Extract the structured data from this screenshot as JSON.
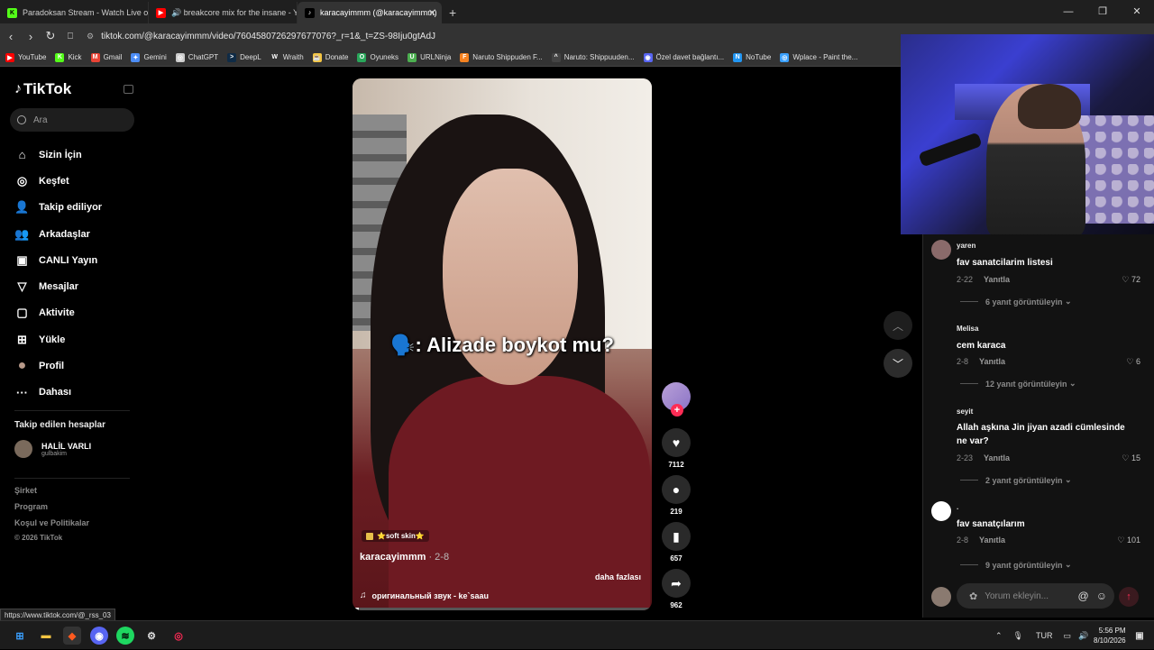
{
  "tabs": [
    {
      "title": "Paradoksan Stream - Watch Live on K",
      "icon_color": "#53fc18",
      "icon_text": "K"
    },
    {
      "title": "🔊 breakcore mix for the insane - Yo",
      "icon_color": "#ff0000",
      "icon_text": "▶"
    },
    {
      "title": "karacayimmm (@karacayimmm)",
      "icon_color": "#000000",
      "icon_text": "♪",
      "active": true
    }
  ],
  "url": "tiktok.com/@karacayimmm/video/7604580726297677076?_r=1&_t=ZS-98Iju0gtAdJ",
  "bookmarks": [
    {
      "label": "YouTube",
      "color": "#ff0000",
      "glyph": "▶"
    },
    {
      "label": "Kick",
      "color": "#53fc18",
      "glyph": "K"
    },
    {
      "label": "Gmail",
      "color": "#ea4335",
      "glyph": "M"
    },
    {
      "label": "Gemini",
      "color": "#4c8df6",
      "glyph": "✦"
    },
    {
      "label": "ChatGPT",
      "color": "#cccccc",
      "glyph": "◎"
    },
    {
      "label": "DeepL",
      "color": "#0f2b46",
      "glyph": ">"
    },
    {
      "label": "Wraith",
      "color": "#333333",
      "glyph": "W"
    },
    {
      "label": "Donate",
      "color": "#f5c542",
      "glyph": "☕"
    },
    {
      "label": "Oyuneks",
      "color": "#29a65a",
      "glyph": "O"
    },
    {
      "label": "URLNinja",
      "color": "#4caf50",
      "glyph": "U"
    },
    {
      "label": "Naruto Shippuden F...",
      "color": "#f58220",
      "glyph": "F"
    },
    {
      "label": "Naruto: Shippuuden...",
      "color": "#444444",
      "glyph": "^"
    },
    {
      "label": "Özel davet bağlantı...",
      "color": "#5865f2",
      "glyph": "◉"
    },
    {
      "label": "NoTube",
      "color": "#2196f3",
      "glyph": "N"
    },
    {
      "label": "Wplace - Paint the...",
      "color": "#3aa0ff",
      "glyph": "◎"
    }
  ],
  "sidebar": {
    "brand": "TikTok",
    "search_placeholder": "Ara",
    "items": [
      {
        "label": "Sizin İçin",
        "icon": "home-icon",
        "glyph": "⌂"
      },
      {
        "label": "Keşfet",
        "icon": "compass-icon",
        "glyph": "◎"
      },
      {
        "label": "Takip ediliyor",
        "icon": "user-follow-icon",
        "glyph": "👤"
      },
      {
        "label": "Arkadaşlar",
        "icon": "friends-icon",
        "glyph": "👥"
      },
      {
        "label": "CANLI Yayın",
        "icon": "live-icon",
        "glyph": "▣"
      },
      {
        "label": "Mesajlar",
        "icon": "messages-icon",
        "glyph": "▽"
      },
      {
        "label": "Aktivite",
        "icon": "activity-icon",
        "glyph": "▢"
      },
      {
        "label": "Yükle",
        "icon": "upload-icon",
        "glyph": "⊞"
      },
      {
        "label": "Profil",
        "icon": "profile-avatar-icon",
        "glyph": "●"
      },
      {
        "label": "Dahası",
        "icon": "more-icon",
        "glyph": "···"
      }
    ],
    "following_title": "Takip edilen hesaplar",
    "following": {
      "name": "HALİL VARLI",
      "handle": "gulbakim"
    },
    "footer": [
      "Şirket",
      "Program",
      "Koşul ve Politikalar"
    ],
    "copyright": "© 2026 TikTok"
  },
  "video": {
    "caption": "🗣️: Alizade boykot mu?",
    "tag": "⭐soft skin⭐",
    "username": "karacayimmm",
    "date": "· 2-8",
    "more": "daha fazlası",
    "sound": "оригинальный звук - ke`saau",
    "progress": 0.02
  },
  "actions": {
    "likes": "7112",
    "comments": "219",
    "saves": "657",
    "shares": "962"
  },
  "comments": [
    {
      "user": "yaren",
      "text": "fav sanatcilarim listesi",
      "date": "2-22",
      "reply": "Yanıtla",
      "likes": "72",
      "replies": "6 yanıt görüntüleyin",
      "avatar": "#8a6a6a"
    },
    {
      "user": "Melisa",
      "text": "cem karaca",
      "date": "2-8",
      "reply": "Yanıtla",
      "likes": "6",
      "replies": "12 yanıt görüntüleyin",
      "avatar": "#121212"
    },
    {
      "user": "seyit",
      "text": "Allah aşkına Jin jiyan azadi cümlesinde ne var?",
      "date": "2-23",
      "reply": "Yanıtla",
      "likes": "15",
      "replies": "2 yanıt görüntüleyin",
      "avatar": "#121212"
    },
    {
      "user": ".",
      "text": "fav sanatçılarım",
      "date": "2-8",
      "reply": "Yanıtla",
      "likes": "101",
      "replies": "9 yanıt görüntüleyin",
      "avatar": "#ffffff"
    }
  ],
  "comment_input_placeholder": "Yorum ekleyin...",
  "status_url": "https://www.tiktok.com/@_rss_03",
  "tray": {
    "lang": "TUR",
    "time": "5:56 PM",
    "date": "8/10/2026"
  },
  "colors": {
    "accent": "#fe2c55",
    "bg": "#000000",
    "panel": "#121212"
  }
}
